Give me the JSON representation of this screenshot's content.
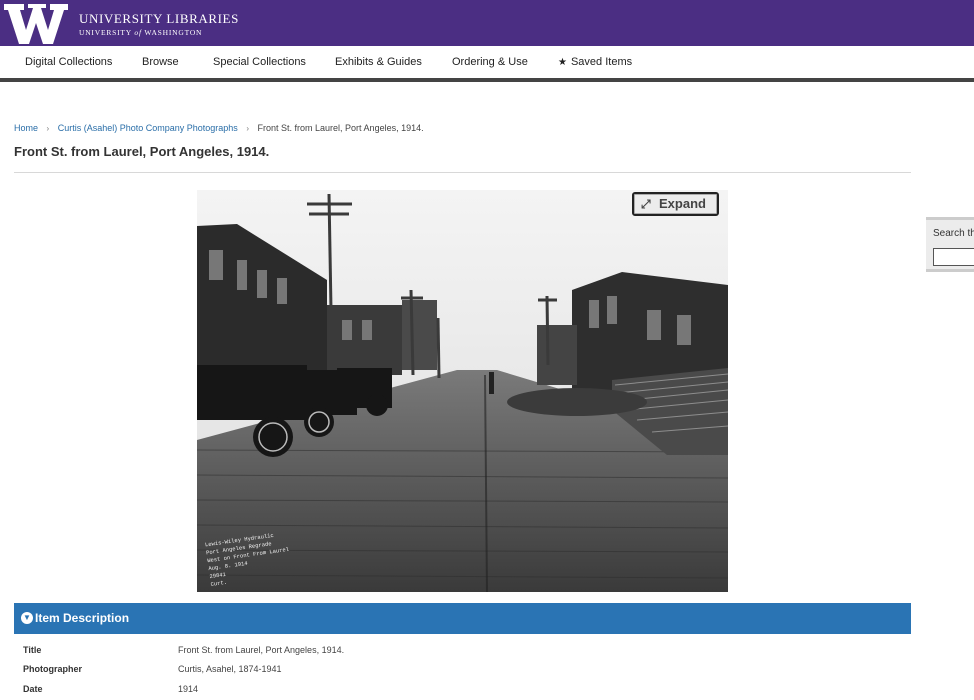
{
  "header": {
    "logo_letter": "W",
    "title": "UNIVERSITY LIBRARIES",
    "subtitle_prefix": "UNIVERSITY",
    "subtitle_of": "of",
    "subtitle_suffix": "WASHINGTON",
    "brand_color": "#4b2e83"
  },
  "nav": {
    "items": [
      {
        "label": "Digital Collections"
      },
      {
        "label": "Browse"
      },
      {
        "label": "Special Collections"
      },
      {
        "label": "Exhibits & Guides"
      },
      {
        "label": "Ordering & Use"
      },
      {
        "label": "Saved Items",
        "icon": "star-icon"
      }
    ]
  },
  "breadcrumb": {
    "items": [
      {
        "label": "Home"
      },
      {
        "label": "Curtis (Asahel) Photo Company Photographs"
      },
      {
        "label": "Front St. from Laurel, Port Angeles, 1914."
      }
    ]
  },
  "page": {
    "title": "Front St. from Laurel, Port Angeles, 1914."
  },
  "viewer": {
    "expand_label": "Expand",
    "caption_lines": [
      "Lewis-Wiley Hydraulic",
      "Port Angeles Regrade",
      "West on Front From Laurel",
      "Aug. 8. 1914",
      "29841",
      "Curt."
    ]
  },
  "side_search": {
    "label": "Search th"
  },
  "item_description": {
    "title": "Item Description",
    "color": "#2a74b4",
    "fields": [
      {
        "label": "Title",
        "value": "Front St. from Laurel, Port Angeles, 1914."
      },
      {
        "label": "Photographer",
        "value": "Curtis, Asahel, 1874-1941"
      },
      {
        "label": "Date",
        "value": "1914"
      }
    ]
  }
}
